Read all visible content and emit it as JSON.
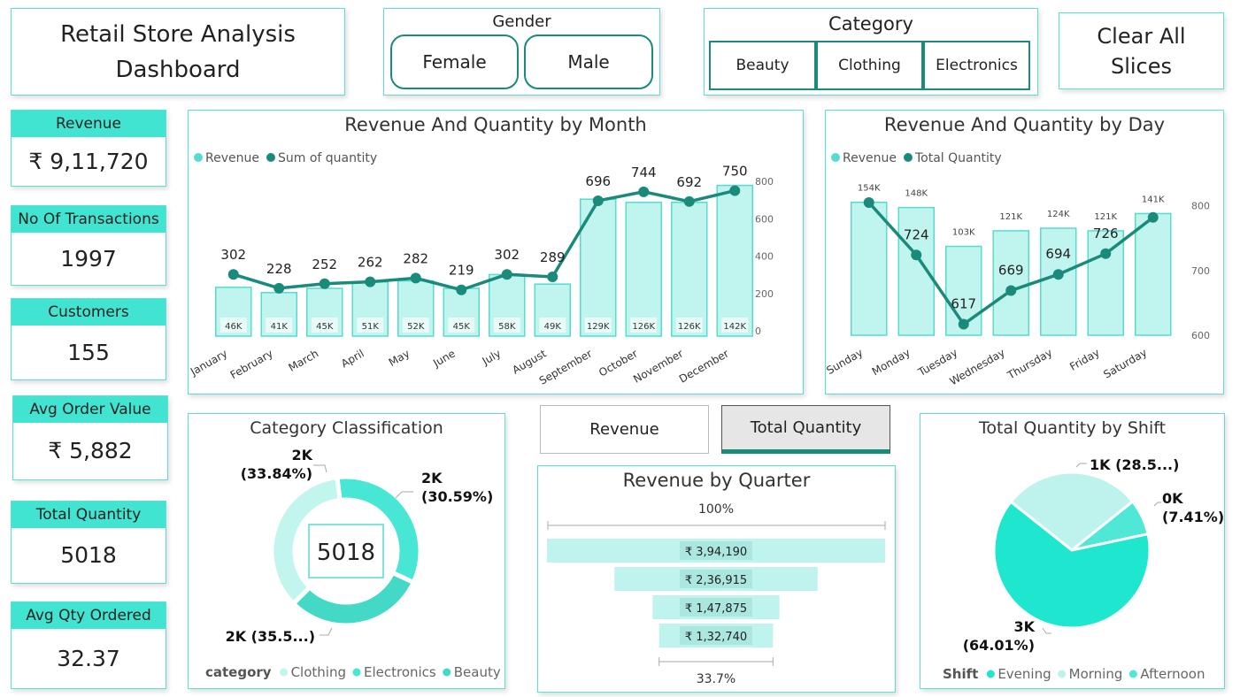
{
  "header": {
    "title": "Retail Store Analysis Dashboard"
  },
  "gender_slicer": {
    "label": "Gender",
    "options": [
      "Female",
      "Male"
    ]
  },
  "category_slicer": {
    "label": "Category",
    "options": [
      "Beauty",
      "Clothing",
      "Electronics"
    ]
  },
  "clear_button": {
    "label": "Clear All Slices"
  },
  "kpis": [
    {
      "label": "Revenue",
      "value": "₹ 9,11,720"
    },
    {
      "label": "No Of Transactions",
      "value": "1997"
    },
    {
      "label": "Customers",
      "value": "155"
    },
    {
      "label": "Avg Order Value",
      "value": "₹ 5,882"
    },
    {
      "label": "Total Quantity",
      "value": "5018"
    },
    {
      "label": "Avg Qty Ordered",
      "value": "32.37"
    }
  ],
  "toggle": {
    "options": [
      "Revenue",
      "Total Quantity"
    ],
    "selected": "Total Quantity"
  },
  "colors": {
    "accent": "#40e4d0",
    "bar": "#c0f5ef",
    "bar_border": "#56dccd",
    "line": "#1a8a7a",
    "pie_evening": "#1ee6cf",
    "pie_morning": "#bdf3ec",
    "pie_afternoon": "#4fe8d6"
  },
  "chart_data": [
    {
      "type": "bar",
      "title": "Revenue And Quantity by Month",
      "legend": [
        "Revenue",
        "Sum of quantity"
      ],
      "legend_position": "top-left",
      "categories": [
        "January",
        "February",
        "March",
        "April",
        "May",
        "June",
        "July",
        "August",
        "September",
        "October",
        "November",
        "December"
      ],
      "series": [
        {
          "name": "Revenue",
          "kind": "bar",
          "values": [
            46000,
            41000,
            45000,
            51000,
            52000,
            45000,
            58000,
            49000,
            129000,
            126000,
            126000,
            142000
          ],
          "labels": [
            "46K",
            "41K",
            "45K",
            "51K",
            "52K",
            "45K",
            "58K",
            "49K",
            "129K",
            "126K",
            "126K",
            "142K"
          ]
        },
        {
          "name": "Sum of quantity",
          "kind": "line",
          "values": [
            302,
            228,
            252,
            262,
            282,
            219,
            302,
            289,
            696,
            744,
            692,
            750
          ]
        }
      ],
      "y2_ticks": [
        "800",
        "600",
        "400",
        "200",
        "0"
      ],
      "y2lim": [
        0,
        800
      ],
      "ylim": [
        0,
        150000
      ]
    },
    {
      "type": "bar",
      "title": "Revenue And Quantity by Day",
      "legend": [
        "Revenue",
        "Total Quantity"
      ],
      "legend_position": "top-left",
      "categories": [
        "Sunday",
        "Monday",
        "Tuesday",
        "Wednesday",
        "Thursday",
        "Friday",
        "Saturday"
      ],
      "series": [
        {
          "name": "Revenue",
          "kind": "bar",
          "values": [
            154000,
            148000,
            103000,
            121000,
            124000,
            121000,
            141000
          ],
          "labels": [
            "154K",
            "148K",
            "103K",
            "121K",
            "124K",
            "121K",
            "141K"
          ]
        },
        {
          "name": "Total Quantity",
          "kind": "line",
          "values": [
            805,
            724,
            617,
            669,
            694,
            726,
            782
          ],
          "labels": [
            "",
            "724",
            "617",
            "669",
            "694",
            "726",
            ""
          ]
        }
      ],
      "y2_ticks": [
        "800",
        "700",
        "600"
      ],
      "y2lim": [
        600,
        820
      ],
      "ylim": [
        0,
        165000
      ]
    },
    {
      "type": "pie",
      "title": "Category Classification",
      "center_label": "5018",
      "legend_title": "category",
      "legend": [
        "Clothing",
        "Electronics",
        "Beauty"
      ],
      "slices": [
        {
          "name": "Electronics",
          "value": 33.84,
          "label": "2K\n(33.84%)"
        },
        {
          "name": "Beauty",
          "value": 30.59,
          "label": "2K\n(30.59%)"
        },
        {
          "name": "Clothing",
          "value": 35.57,
          "label": "2K (35.5...)"
        }
      ]
    },
    {
      "type": "bar",
      "title": "Revenue by Quarter",
      "top_label": "100%",
      "bottom_label": "33.7%",
      "values": [
        394190,
        236915,
        147875,
        132740
      ],
      "labels": [
        "₹ 3,94,190",
        "₹ 2,36,915",
        "₹ 1,47,875",
        "₹ 1,32,740"
      ]
    },
    {
      "type": "pie",
      "title": "Total Quantity by Shift",
      "legend_title": "Shift",
      "legend": [
        "Evening",
        "Morning",
        "Afternoon"
      ],
      "slices": [
        {
          "name": "Evening",
          "value": 64.01,
          "label": "3K\n(64.01%)"
        },
        {
          "name": "Morning",
          "value": 28.58,
          "label": "1K (28.5...)"
        },
        {
          "name": "Afternoon",
          "value": 7.41,
          "label": "0K\n(7.41%)"
        }
      ]
    }
  ]
}
